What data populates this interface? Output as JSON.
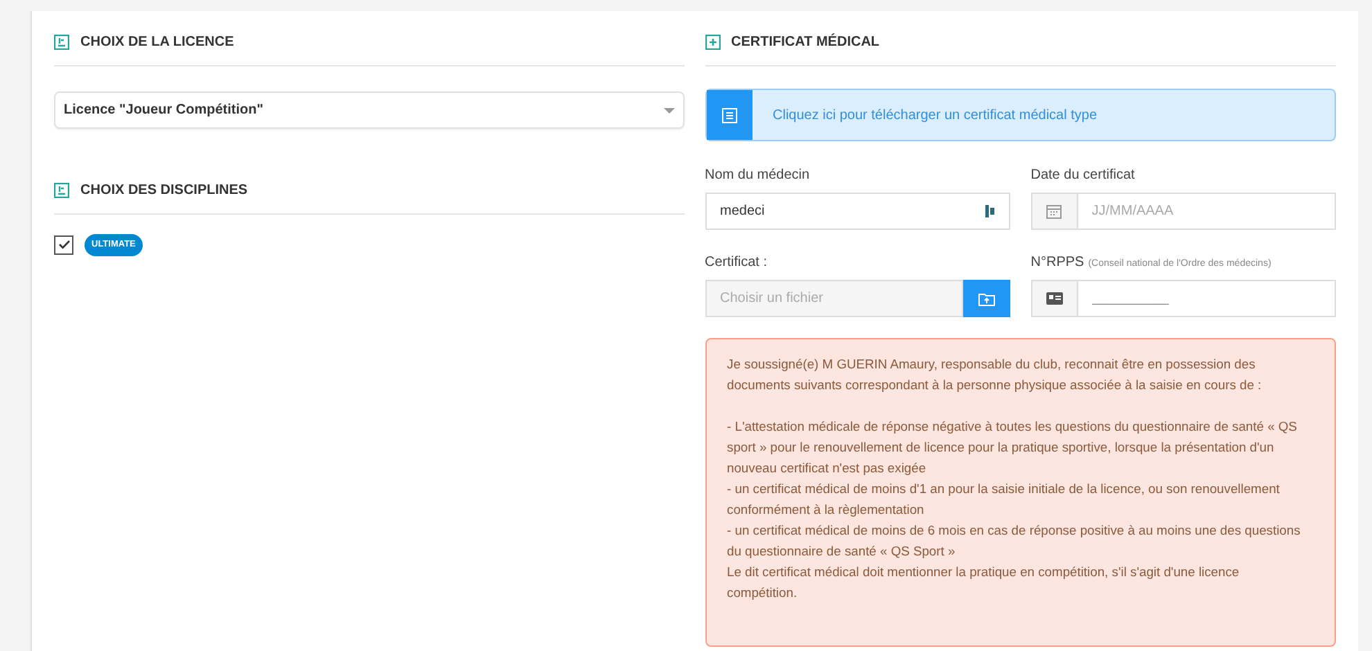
{
  "licence_section": {
    "title": "CHOIX DE LA LICENCE",
    "select": {
      "value": "Licence \"Joueur Compétition\""
    }
  },
  "disciplines_section": {
    "title": "CHOIX DES DISCIPLINES",
    "items": [
      {
        "label": "ULTIMATE",
        "checked": true
      }
    ]
  },
  "certificate_section": {
    "title": "CERTIFICAT MÉDICAL",
    "download_banner": "Cliquez ici pour télécharger un certificat médical type",
    "doctor_name": {
      "label": "Nom du médecin",
      "value": "medeci"
    },
    "certificate_date": {
      "label": "Date du certificat",
      "placeholder": "JJ/MM/AAAA"
    },
    "certificate_file": {
      "label": "Certificat :",
      "placeholder": "Choisir un fichier"
    },
    "rpps": {
      "label": "N°RPPS",
      "hint": "(Conseil national de l'Ordre des médecins)",
      "placeholder": "__________"
    },
    "notice": {
      "intro": "Je soussigné(e) M GUERIN Amaury, responsable du club, reconnait être en possession des documents suivants correspondant à la personne physique associée à la saisie en cours de :",
      "lines": [
        "- L'attestation médicale de réponse négative à toutes les questions du questionnaire de santé « QS sport » pour le renouvellement de licence pour la pratique sportive, lorsque la présentation d'un nouveau certificat n'est pas exigée",
        "- un certificat médical de moins d'1 an pour la saisie initiale de la licence, ou son renouvellement conformément à la règlementation",
        "- un certificat médical de moins de 6 mois en cas de réponse positive à au moins une des questions du questionnaire de santé « QS Sport »",
        "Le dit certificat médical doit mentionner la pratique en compétition, s'il s'agit d'une licence compétition."
      ]
    }
  }
}
